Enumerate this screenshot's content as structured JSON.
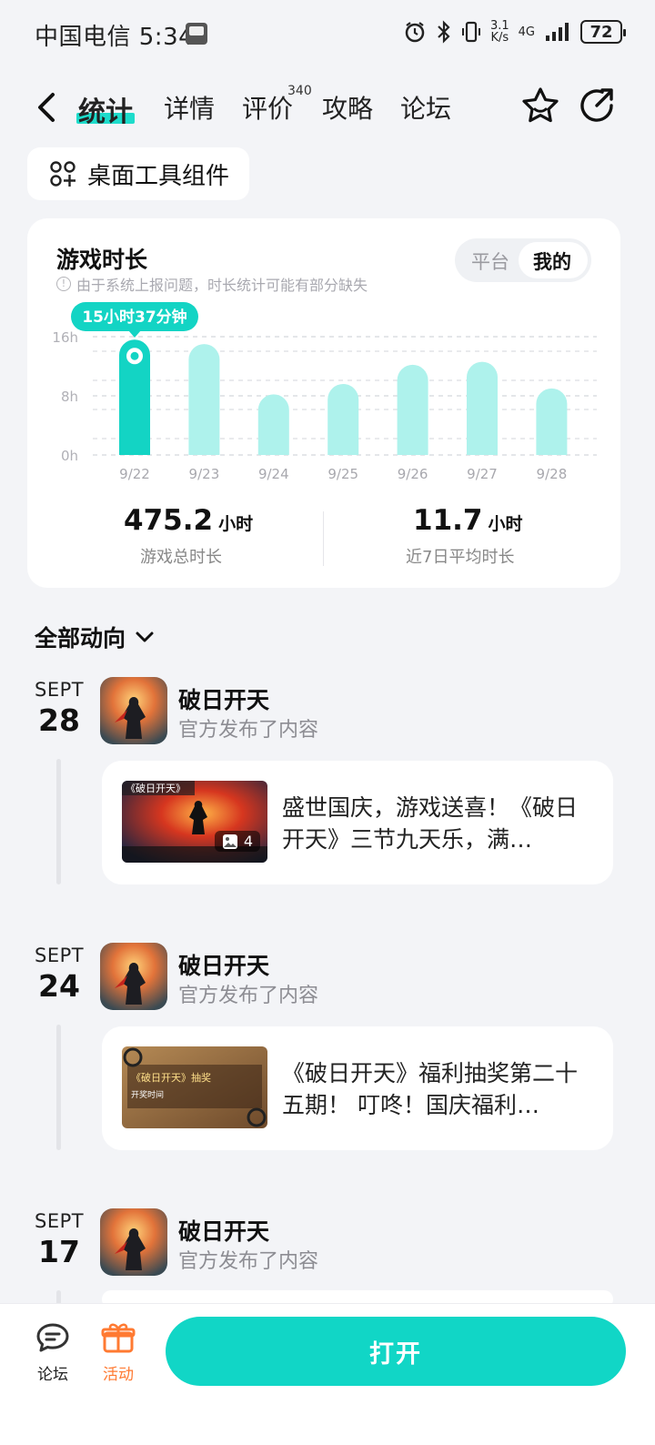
{
  "status_bar": {
    "carrier_time": "中国电信 5:34",
    "net_speed_top": "3.1",
    "net_speed_bottom": "K/s",
    "network": "4G",
    "battery": "72"
  },
  "nav": {
    "tabs": [
      {
        "label": "统计",
        "active": true
      },
      {
        "label": "详情"
      },
      {
        "label": "评价",
        "badge": "340"
      },
      {
        "label": "攻略"
      },
      {
        "label": "论坛"
      }
    ]
  },
  "widget": {
    "label": "桌面工具组件"
  },
  "playtime": {
    "title": "游戏时长",
    "note": "由于系统上报问题，时长统计可能有部分缺失",
    "segment": {
      "options": [
        "平台",
        "我的"
      ],
      "selected": "我的"
    },
    "tooltip": "15小时37分钟",
    "total_value": "475.2",
    "total_unit": "小时",
    "total_label": "游戏总时长",
    "avg_value": "11.7",
    "avg_unit": "小时",
    "avg_label": "近7日平均时长"
  },
  "chart_data": {
    "type": "bar",
    "categories": [
      "9/22",
      "9/23",
      "9/24",
      "9/25",
      "9/26",
      "9/27",
      "9/28"
    ],
    "values": [
      15.6,
      15,
      8.2,
      9.6,
      12.2,
      12.6,
      9
    ],
    "yticks": [
      "0h",
      "8h",
      "16h"
    ],
    "ylim": [
      0,
      16
    ],
    "highlight_index": 0,
    "colors": {
      "highlight": "#13d4c4",
      "normal": "#aef2ec",
      "grid": "#dcdde2"
    }
  },
  "feed": {
    "title": "全部动向",
    "items": [
      {
        "month": "SEPT",
        "day": "28",
        "game": "破日开天",
        "action": "官方发布了内容",
        "text": "盛世国庆，游戏送喜！《破日开天》三节九天乐，满…",
        "image_count": "4"
      },
      {
        "month": "SEPT",
        "day": "24",
        "game": "破日开天",
        "action": "官方发布了内容",
        "text": "《破日开天》福利抽奖第二十五期！ 叮咚！国庆福利…"
      },
      {
        "month": "SEPT",
        "day": "17",
        "game": "破日开天",
        "action": "官方发布了内容"
      }
    ]
  },
  "bottom_bar": {
    "forum_label": "论坛",
    "activity_label": "活动",
    "open_label": "打开",
    "accent": "#ff7a32"
  }
}
